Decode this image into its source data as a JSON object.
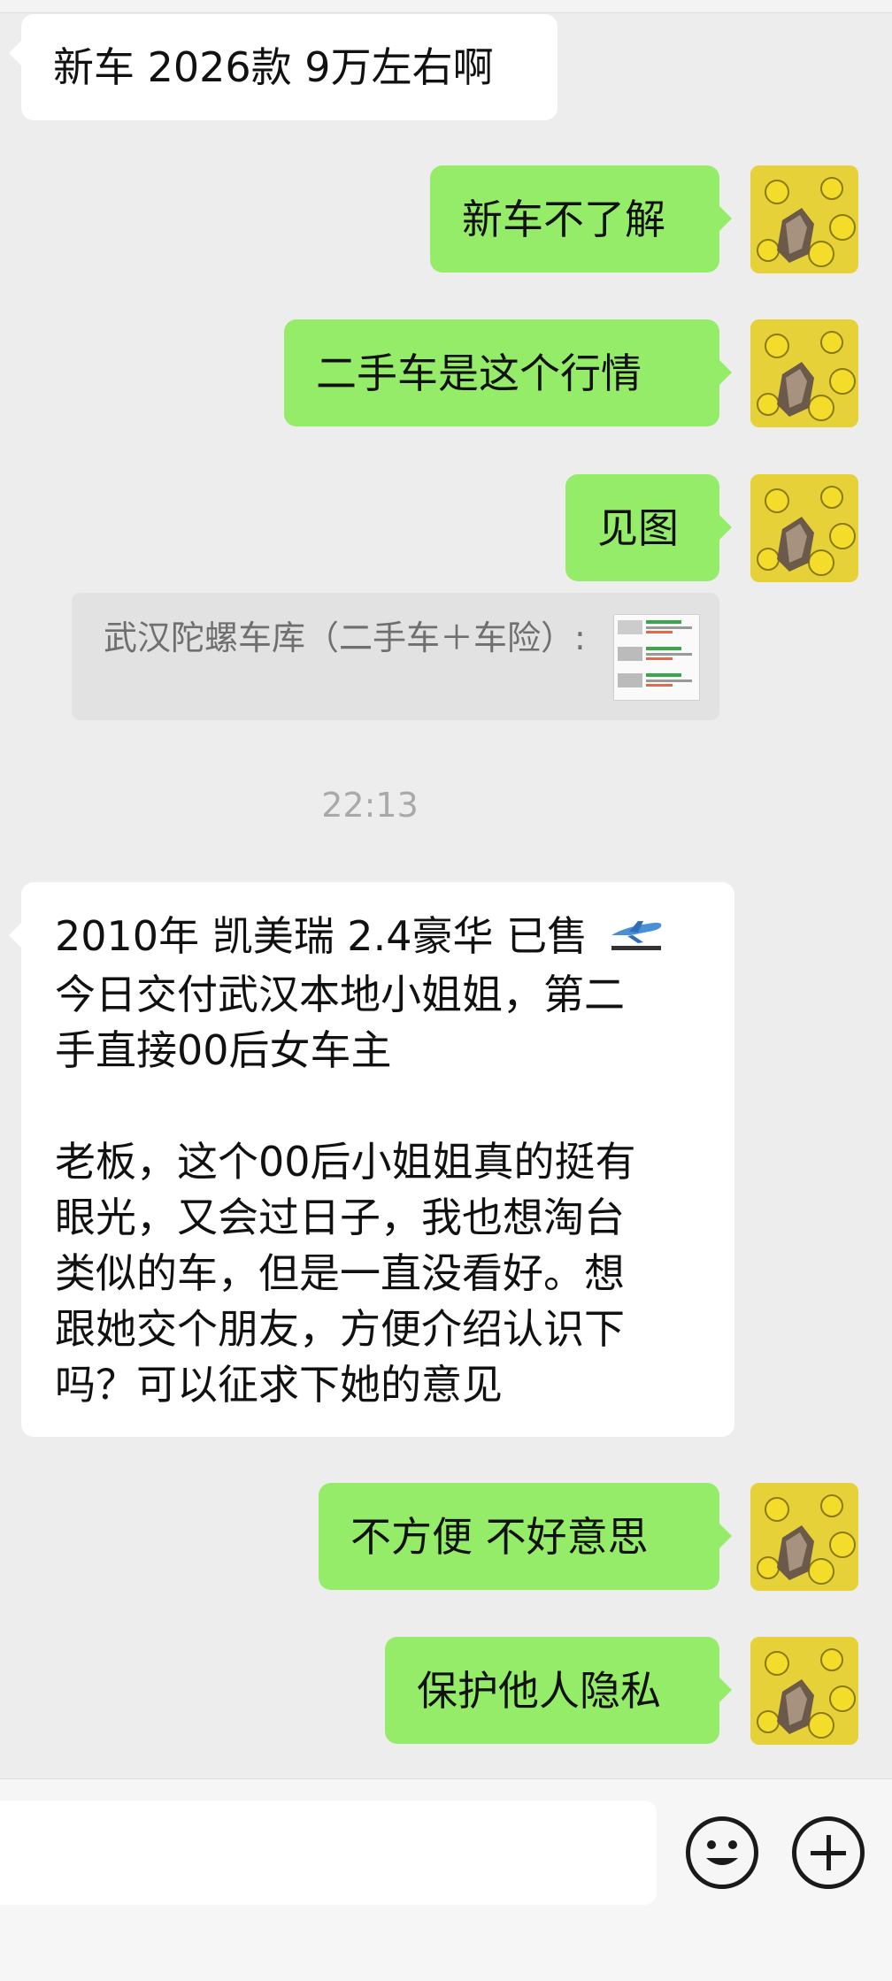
{
  "messages": {
    "m1": "新车 2026款 9万左右啊",
    "m2": "新车不了解",
    "m3": "二手车是这个行情",
    "m4": "见图",
    "m5": "不方便 不好意思",
    "m6": "保护他人隐私"
  },
  "quote": {
    "text": "武汉陀螺车库（二手车＋车险）:"
  },
  "timestamp": "22:13",
  "long_message": {
    "line1": "2010年 凯美瑞 2.4豪华 已售",
    "line2": "今日交付武汉本地小姐姐，第二",
    "line3": "手直接00后女车主",
    "line4": "老板，这个00后小姐姐真的挺有",
    "line5": "眼光，又会过日子，我也想淘台",
    "line6": "类似的车，但是一直没看好。想",
    "line7": "跟她交个朋友，方便介绍认识下",
    "line8": "吗？可以征求下她的意见"
  },
  "icons": {
    "emoji": "emoji-icon",
    "plus": "plus-icon",
    "plane": "airplane-icon"
  },
  "colors": {
    "background": "#ededed",
    "bubble_self": "#95ec69",
    "bubble_other": "#ffffff"
  }
}
